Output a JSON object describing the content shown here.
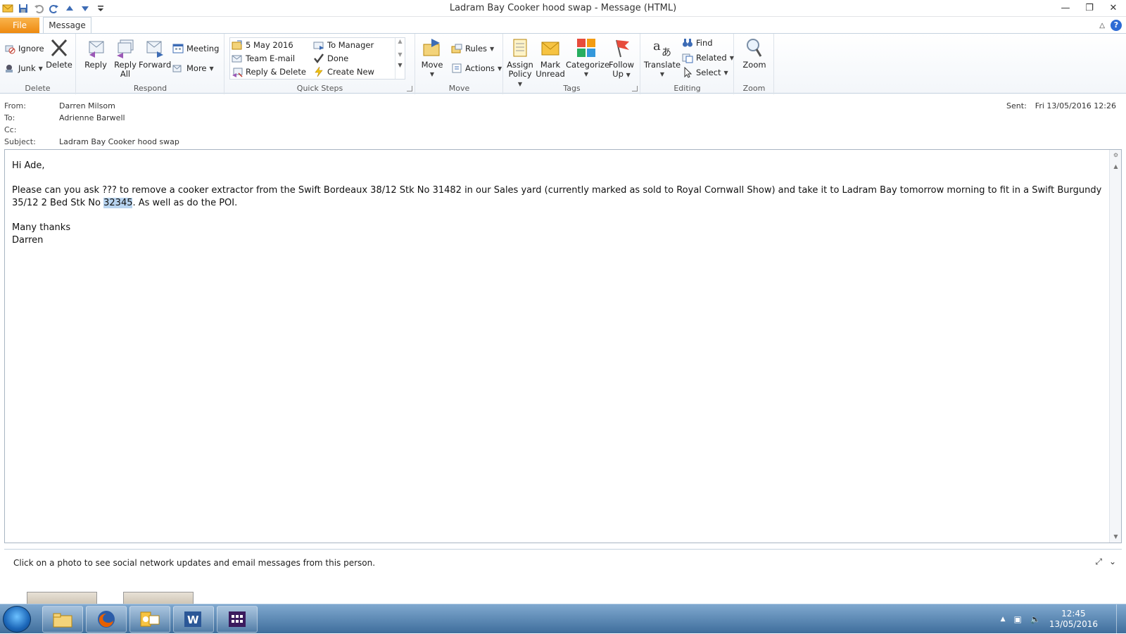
{
  "window": {
    "title": "Ladram Bay Cooker hood swap  -  Message (HTML)"
  },
  "tabs": {
    "file": "File",
    "message": "Message"
  },
  "ribbon": {
    "delete_group": {
      "label": "Delete",
      "ignore": "Ignore",
      "junk": "Junk",
      "delete": "Delete"
    },
    "respond_group": {
      "label": "Respond",
      "reply": "Reply",
      "reply_all_1": "Reply",
      "reply_all_2": "All",
      "forward": "Forward",
      "meeting": "Meeting",
      "more": "More"
    },
    "quick_steps_group": {
      "label": "Quick Steps",
      "items": [
        "5 May 2016",
        "Team E-mail",
        "Reply & Delete",
        "To Manager",
        "Done",
        "Create New"
      ]
    },
    "move_group": {
      "label": "Move",
      "move": "Move",
      "rules": "Rules",
      "actions": "Actions"
    },
    "tags_group": {
      "label": "Tags",
      "assign_policy_1": "Assign",
      "assign_policy_2": "Policy",
      "mark_unread_1": "Mark",
      "mark_unread_2": "Unread",
      "categorize": "Categorize",
      "follow_up_1": "Follow",
      "follow_up_2": "Up"
    },
    "editing_group": {
      "label": "Editing",
      "translate": "Translate",
      "find": "Find",
      "related": "Related",
      "select": "Select"
    },
    "zoom_group": {
      "label": "Zoom",
      "zoom": "Zoom"
    }
  },
  "header": {
    "from_label": "From:",
    "from_value": "Darren Milsom",
    "to_label": "To:",
    "to_value": "Adrienne Barwell",
    "cc_label": "Cc:",
    "cc_value": "",
    "subject_label": "Subject:",
    "subject_value": "Ladram Bay Cooker hood swap",
    "sent_label": "Sent:",
    "sent_value": "Fri 13/05/2016 12:26"
  },
  "message": {
    "greeting": "Hi Ade,",
    "para_a": "Please can you ask ??? to remove a cooker extractor from the Swift Bordeaux 38/12 Stk No 31482 in our Sales yard (currently marked as sold to Royal Cornwall Show) and take it to Ladram Bay tomorrow morning to fit in a Swift Burgundy 35/12 2 Bed Stk No ",
    "para_highlight": "32345",
    "para_b": ". As well as do the POI.",
    "closing": "Many thanks",
    "signature": "Darren"
  },
  "people_pane": {
    "text": "Click on a photo to see social network updates and email messages from this person."
  },
  "taskbar": {
    "time": "12:45",
    "date": "13/05/2016"
  },
  "colors": {
    "file_tab": "#ee8a10",
    "highlight": "#b8d4f0",
    "taskbar": "#3f6e9c"
  }
}
